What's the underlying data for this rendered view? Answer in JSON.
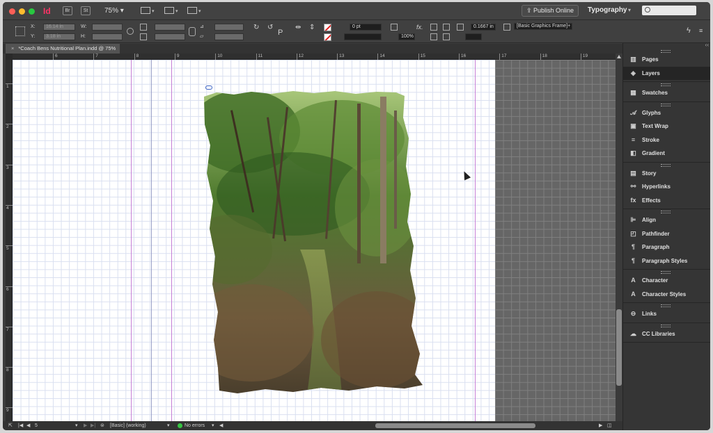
{
  "app": {
    "logo": "Id",
    "bridge": "Br",
    "stock": "St",
    "zoom": "75%",
    "publish_label": "Publish Online",
    "workspace": "Typography"
  },
  "control_bar": {
    "x_label": "X:",
    "x_value": "16.14 in",
    "y_label": "Y:",
    "y_value": "3.18 in",
    "w_label": "W:",
    "h_label": "H:",
    "stroke_weight": "0 pt",
    "opacity": "100%",
    "corner_value": "0.1667 in",
    "object_style": "[Basic Graphics Frame]+"
  },
  "document": {
    "tab_title": "*Coach Bens Nutritional Plan.indd @ 75%",
    "close": "×"
  },
  "rulers": {
    "horizontal": [
      "6",
      "7",
      "8",
      "9",
      "10",
      "11",
      "12",
      "13",
      "14",
      "15",
      "16",
      "17",
      "18",
      "19"
    ],
    "vertical": [
      "1",
      "2",
      "3",
      "4",
      "5",
      "6",
      "7",
      "8",
      "9"
    ]
  },
  "status_bar": {
    "page": "5",
    "style": "[Basic] (working)",
    "preflight": "No errors"
  },
  "panels": [
    {
      "items": [
        {
          "label": "Pages",
          "icon": "pages-icon",
          "glyph": "▥"
        },
        {
          "label": "Layers",
          "icon": "layers-icon",
          "glyph": "◈",
          "selected": true
        }
      ]
    },
    {
      "items": [
        {
          "label": "Swatches",
          "icon": "swatches-icon",
          "glyph": "▦"
        }
      ]
    },
    {
      "items": [
        {
          "label": "Glyphs",
          "icon": "glyphs-icon",
          "glyph": "𝒜"
        },
        {
          "label": "Text Wrap",
          "icon": "text-wrap-icon",
          "glyph": "▣"
        },
        {
          "label": "Stroke",
          "icon": "stroke-icon",
          "glyph": "≡"
        },
        {
          "label": "Gradient",
          "icon": "gradient-icon",
          "glyph": "◧"
        }
      ]
    },
    {
      "items": [
        {
          "label": "Story",
          "icon": "story-icon",
          "glyph": "▤"
        },
        {
          "label": "Hyperlinks",
          "icon": "hyperlinks-icon",
          "glyph": "⚯"
        },
        {
          "label": "Effects",
          "icon": "effects-icon",
          "glyph": "fx"
        }
      ]
    },
    {
      "items": [
        {
          "label": "Align",
          "icon": "align-icon",
          "glyph": "⊫"
        },
        {
          "label": "Pathfinder",
          "icon": "pathfinder-icon",
          "glyph": "◰"
        },
        {
          "label": "Paragraph",
          "icon": "paragraph-icon",
          "glyph": "¶"
        },
        {
          "label": "Paragraph Styles",
          "icon": "paragraph-styles-icon",
          "glyph": "¶"
        }
      ]
    },
    {
      "items": [
        {
          "label": "Character",
          "icon": "character-icon",
          "glyph": "A"
        },
        {
          "label": "Character Styles",
          "icon": "character-styles-icon",
          "glyph": "A"
        }
      ]
    },
    {
      "items": [
        {
          "label": "Links",
          "icon": "links-icon",
          "glyph": "⊖"
        }
      ]
    },
    {
      "items": [
        {
          "label": "CC Libraries",
          "icon": "cc-libraries-icon",
          "glyph": "☁"
        }
      ]
    }
  ],
  "colors": {
    "traffic_red": "#fc5f57",
    "traffic_yellow": "#fdbc2e",
    "traffic_green": "#28c840",
    "indesign_pink": "#ff3366",
    "margin_guide": "#c67fd6",
    "preflight_ok": "#37c443"
  }
}
